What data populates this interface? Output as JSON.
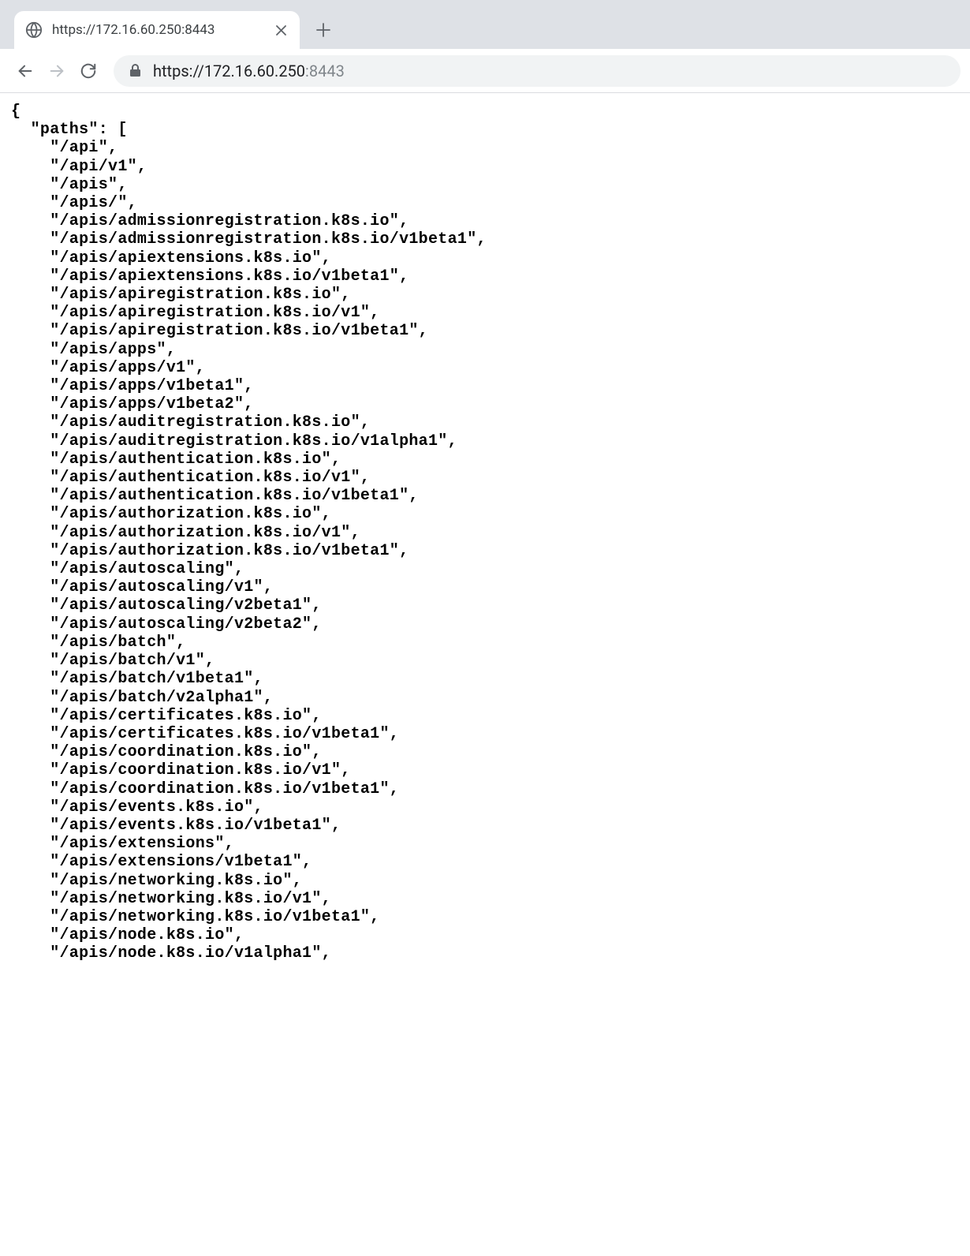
{
  "tab": {
    "title": "https://172.16.60.250:8443"
  },
  "url": {
    "scheme_host": "https://172.16.60.250",
    "port": ":8443"
  },
  "json": {
    "key": "paths",
    "paths": [
      "/api",
      "/api/v1",
      "/apis",
      "/apis/",
      "/apis/admissionregistration.k8s.io",
      "/apis/admissionregistration.k8s.io/v1beta1",
      "/apis/apiextensions.k8s.io",
      "/apis/apiextensions.k8s.io/v1beta1",
      "/apis/apiregistration.k8s.io",
      "/apis/apiregistration.k8s.io/v1",
      "/apis/apiregistration.k8s.io/v1beta1",
      "/apis/apps",
      "/apis/apps/v1",
      "/apis/apps/v1beta1",
      "/apis/apps/v1beta2",
      "/apis/auditregistration.k8s.io",
      "/apis/auditregistration.k8s.io/v1alpha1",
      "/apis/authentication.k8s.io",
      "/apis/authentication.k8s.io/v1",
      "/apis/authentication.k8s.io/v1beta1",
      "/apis/authorization.k8s.io",
      "/apis/authorization.k8s.io/v1",
      "/apis/authorization.k8s.io/v1beta1",
      "/apis/autoscaling",
      "/apis/autoscaling/v1",
      "/apis/autoscaling/v2beta1",
      "/apis/autoscaling/v2beta2",
      "/apis/batch",
      "/apis/batch/v1",
      "/apis/batch/v1beta1",
      "/apis/batch/v2alpha1",
      "/apis/certificates.k8s.io",
      "/apis/certificates.k8s.io/v1beta1",
      "/apis/coordination.k8s.io",
      "/apis/coordination.k8s.io/v1",
      "/apis/coordination.k8s.io/v1beta1",
      "/apis/events.k8s.io",
      "/apis/events.k8s.io/v1beta1",
      "/apis/extensions",
      "/apis/extensions/v1beta1",
      "/apis/networking.k8s.io",
      "/apis/networking.k8s.io/v1",
      "/apis/networking.k8s.io/v1beta1",
      "/apis/node.k8s.io",
      "/apis/node.k8s.io/v1alpha1"
    ]
  }
}
